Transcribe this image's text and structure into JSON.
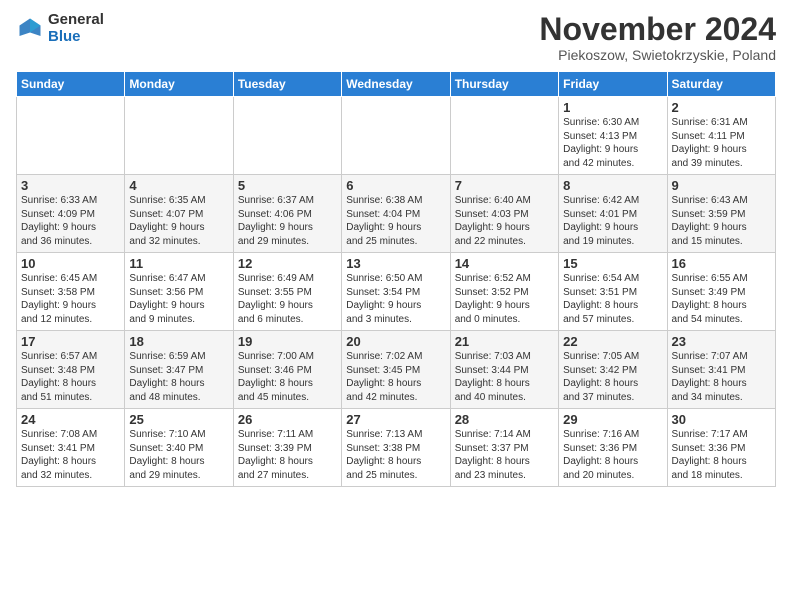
{
  "logo": {
    "general": "General",
    "blue": "Blue"
  },
  "header": {
    "month": "November 2024",
    "location": "Piekoszow, Swietokrzyskie, Poland"
  },
  "days_of_week": [
    "Sunday",
    "Monday",
    "Tuesday",
    "Wednesday",
    "Thursday",
    "Friday",
    "Saturday"
  ],
  "weeks": [
    [
      {
        "day": "",
        "info": ""
      },
      {
        "day": "",
        "info": ""
      },
      {
        "day": "",
        "info": ""
      },
      {
        "day": "",
        "info": ""
      },
      {
        "day": "",
        "info": ""
      },
      {
        "day": "1",
        "info": "Sunrise: 6:30 AM\nSunset: 4:13 PM\nDaylight: 9 hours\nand 42 minutes."
      },
      {
        "day": "2",
        "info": "Sunrise: 6:31 AM\nSunset: 4:11 PM\nDaylight: 9 hours\nand 39 minutes."
      }
    ],
    [
      {
        "day": "3",
        "info": "Sunrise: 6:33 AM\nSunset: 4:09 PM\nDaylight: 9 hours\nand 36 minutes."
      },
      {
        "day": "4",
        "info": "Sunrise: 6:35 AM\nSunset: 4:07 PM\nDaylight: 9 hours\nand 32 minutes."
      },
      {
        "day": "5",
        "info": "Sunrise: 6:37 AM\nSunset: 4:06 PM\nDaylight: 9 hours\nand 29 minutes."
      },
      {
        "day": "6",
        "info": "Sunrise: 6:38 AM\nSunset: 4:04 PM\nDaylight: 9 hours\nand 25 minutes."
      },
      {
        "day": "7",
        "info": "Sunrise: 6:40 AM\nSunset: 4:03 PM\nDaylight: 9 hours\nand 22 minutes."
      },
      {
        "day": "8",
        "info": "Sunrise: 6:42 AM\nSunset: 4:01 PM\nDaylight: 9 hours\nand 19 minutes."
      },
      {
        "day": "9",
        "info": "Sunrise: 6:43 AM\nSunset: 3:59 PM\nDaylight: 9 hours\nand 15 minutes."
      }
    ],
    [
      {
        "day": "10",
        "info": "Sunrise: 6:45 AM\nSunset: 3:58 PM\nDaylight: 9 hours\nand 12 minutes."
      },
      {
        "day": "11",
        "info": "Sunrise: 6:47 AM\nSunset: 3:56 PM\nDaylight: 9 hours\nand 9 minutes."
      },
      {
        "day": "12",
        "info": "Sunrise: 6:49 AM\nSunset: 3:55 PM\nDaylight: 9 hours\nand 6 minutes."
      },
      {
        "day": "13",
        "info": "Sunrise: 6:50 AM\nSunset: 3:54 PM\nDaylight: 9 hours\nand 3 minutes."
      },
      {
        "day": "14",
        "info": "Sunrise: 6:52 AM\nSunset: 3:52 PM\nDaylight: 9 hours\nand 0 minutes."
      },
      {
        "day": "15",
        "info": "Sunrise: 6:54 AM\nSunset: 3:51 PM\nDaylight: 8 hours\nand 57 minutes."
      },
      {
        "day": "16",
        "info": "Sunrise: 6:55 AM\nSunset: 3:49 PM\nDaylight: 8 hours\nand 54 minutes."
      }
    ],
    [
      {
        "day": "17",
        "info": "Sunrise: 6:57 AM\nSunset: 3:48 PM\nDaylight: 8 hours\nand 51 minutes."
      },
      {
        "day": "18",
        "info": "Sunrise: 6:59 AM\nSunset: 3:47 PM\nDaylight: 8 hours\nand 48 minutes."
      },
      {
        "day": "19",
        "info": "Sunrise: 7:00 AM\nSunset: 3:46 PM\nDaylight: 8 hours\nand 45 minutes."
      },
      {
        "day": "20",
        "info": "Sunrise: 7:02 AM\nSunset: 3:45 PM\nDaylight: 8 hours\nand 42 minutes."
      },
      {
        "day": "21",
        "info": "Sunrise: 7:03 AM\nSunset: 3:44 PM\nDaylight: 8 hours\nand 40 minutes."
      },
      {
        "day": "22",
        "info": "Sunrise: 7:05 AM\nSunset: 3:42 PM\nDaylight: 8 hours\nand 37 minutes."
      },
      {
        "day": "23",
        "info": "Sunrise: 7:07 AM\nSunset: 3:41 PM\nDaylight: 8 hours\nand 34 minutes."
      }
    ],
    [
      {
        "day": "24",
        "info": "Sunrise: 7:08 AM\nSunset: 3:41 PM\nDaylight: 8 hours\nand 32 minutes."
      },
      {
        "day": "25",
        "info": "Sunrise: 7:10 AM\nSunset: 3:40 PM\nDaylight: 8 hours\nand 29 minutes."
      },
      {
        "day": "26",
        "info": "Sunrise: 7:11 AM\nSunset: 3:39 PM\nDaylight: 8 hours\nand 27 minutes."
      },
      {
        "day": "27",
        "info": "Sunrise: 7:13 AM\nSunset: 3:38 PM\nDaylight: 8 hours\nand 25 minutes."
      },
      {
        "day": "28",
        "info": "Sunrise: 7:14 AM\nSunset: 3:37 PM\nDaylight: 8 hours\nand 23 minutes."
      },
      {
        "day": "29",
        "info": "Sunrise: 7:16 AM\nSunset: 3:36 PM\nDaylight: 8 hours\nand 20 minutes."
      },
      {
        "day": "30",
        "info": "Sunrise: 7:17 AM\nSunset: 3:36 PM\nDaylight: 8 hours\nand 18 minutes."
      }
    ]
  ]
}
